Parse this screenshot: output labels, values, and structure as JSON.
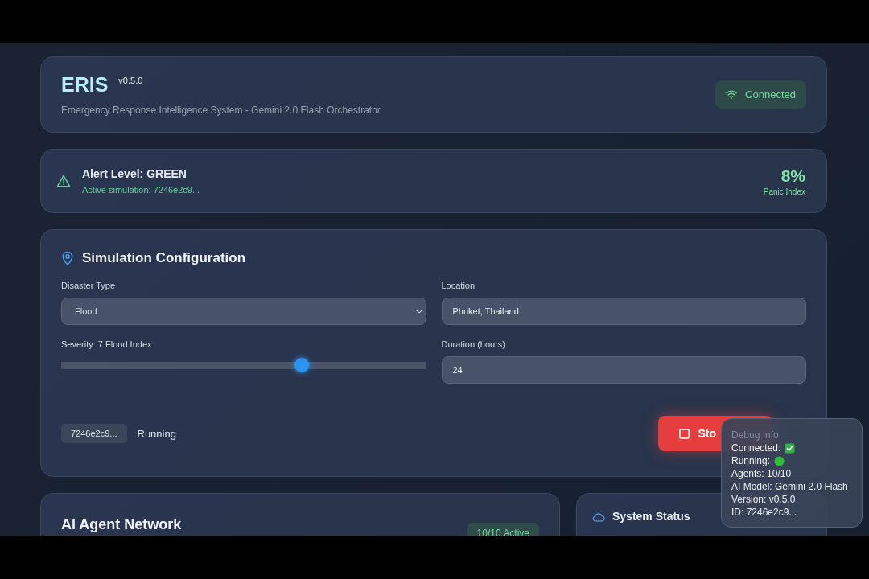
{
  "header": {
    "title": "ERIS",
    "version": "v0.5.0",
    "subtitle": "Emergency Response Intelligence System - Gemini 2.0 Flash Orchestrator",
    "connection": {
      "label": "Connected",
      "connected": true
    }
  },
  "alert": {
    "title": "Alert Level: GREEN",
    "detail": "Active simulation: 7246e2c9...",
    "panic_value": "8%",
    "panic_label": "Panic Index"
  },
  "config": {
    "title": "Simulation Configuration",
    "disaster_type": {
      "label": "Disaster Type",
      "value": "Flood"
    },
    "location": {
      "label": "Location",
      "value": "Phuket, Thailand"
    },
    "severity": {
      "label": "Severity: 7 Flood Index",
      "level": 0.66
    },
    "duration": {
      "label": "Duration (hours)",
      "value": "24"
    },
    "sim_id": "7246e2c9...",
    "status": "Running",
    "running": true,
    "stop_button": "Sto"
  },
  "agents": {
    "title": "AI Agent Network",
    "badge": "10/10 Active"
  },
  "system_status": {
    "title": "System Status"
  },
  "debug": {
    "title": "Debug Info",
    "connected_label": "Connected:",
    "connected": true,
    "running_label": "Running:",
    "running": true,
    "lines": [
      "Agents: 10/10",
      "AI Model: Gemini 2.0 Flash",
      "Version: v0.5.0",
      "ID: 7246e2c9..."
    ]
  }
}
